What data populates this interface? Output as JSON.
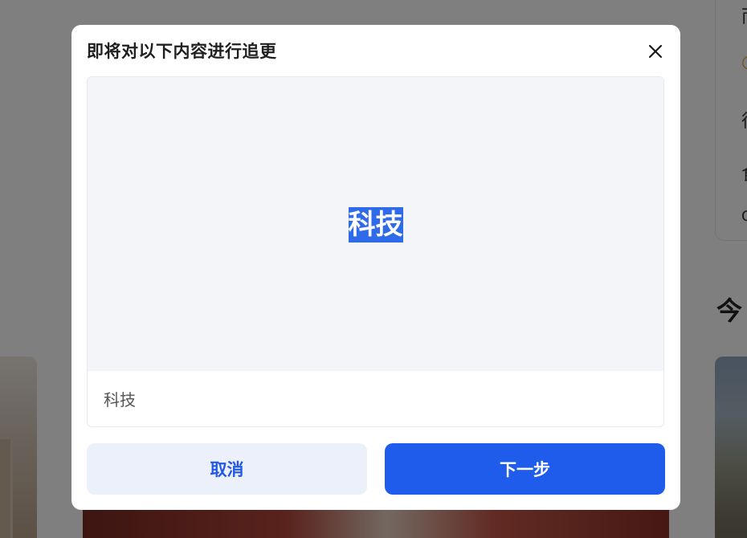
{
  "background": {
    "right_panel_glyphs": [
      "而",
      "○",
      "很",
      "食",
      "C"
    ],
    "right_heading": "今"
  },
  "dialog": {
    "title": "即将对以下内容进行追更",
    "close_icon": "close-icon",
    "preview_tag": "科技",
    "caption": "科技",
    "cancel_label": "取消",
    "next_label": "下一步"
  },
  "colors": {
    "primary": "#1f5cec",
    "cancel_bg": "#ecf0fb",
    "preview_bg": "#f4f5f9",
    "overlay": "rgba(0,0,0,0.5)"
  }
}
